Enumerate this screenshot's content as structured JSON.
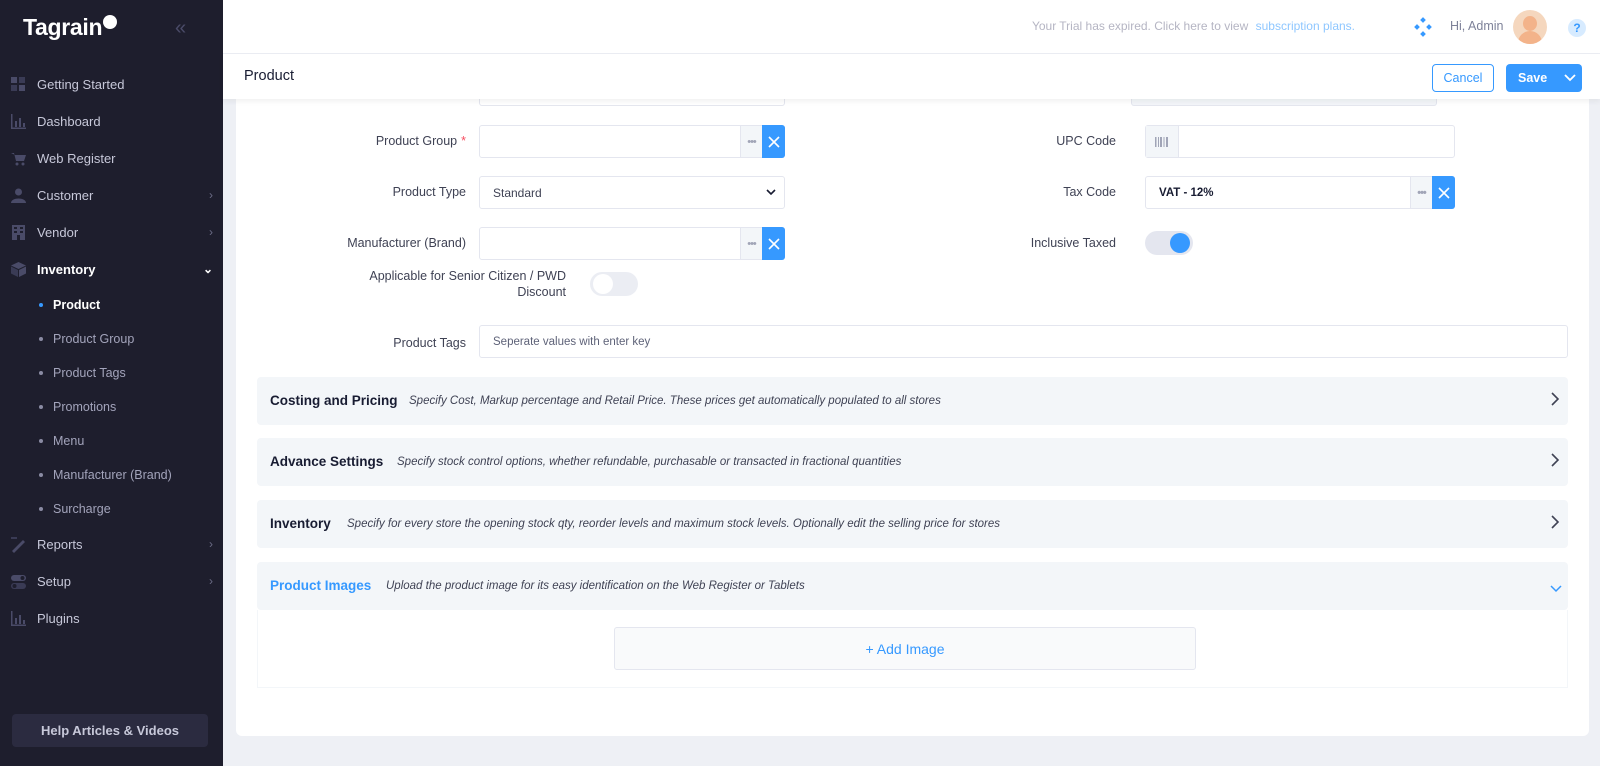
{
  "app": {
    "logo_text": "Tagrain",
    "help_label": "Help Articles & Videos"
  },
  "sidebar": {
    "items": [
      {
        "label": "Getting Started",
        "icon": "grid-icon"
      },
      {
        "label": "Dashboard",
        "icon": "bar-chart-icon"
      },
      {
        "label": "Web Register",
        "icon": "cart-icon"
      },
      {
        "label": "Customer",
        "icon": "user-icon"
      },
      {
        "label": "Vendor",
        "icon": "building-icon"
      },
      {
        "label": "Inventory",
        "icon": "box-icon"
      },
      {
        "label": "Reports",
        "icon": "pencil-ruler-icon"
      },
      {
        "label": "Setup",
        "icon": "toggle-icon"
      },
      {
        "label": "Plugins",
        "icon": "bar-chart-icon"
      }
    ],
    "inventory_sub": [
      "Product",
      "Product Group",
      "Product Tags",
      "Promotions",
      "Menu",
      "Manufacturer (Brand)",
      "Surcharge"
    ]
  },
  "topbar": {
    "trial_text": "Your Trial has expired. Click here to view",
    "trial_link": "subscription plans.",
    "greeting": "Hi, Admin",
    "help_glyph": "?"
  },
  "subheader": {
    "title": "Product",
    "cancel": "Cancel",
    "save": "Save"
  },
  "form": {
    "product_group": {
      "label": "Product Group",
      "required_mark": "*",
      "value": ""
    },
    "product_type": {
      "label": "Product Type",
      "value": "Standard"
    },
    "manufacturer": {
      "label": "Manufacturer (Brand)",
      "value": ""
    },
    "senior_discount": {
      "label_line1": "Applicable for Senior Citizen / PWD",
      "label_line2": "Discount",
      "enabled": false
    },
    "upc_code": {
      "label": "UPC Code",
      "value": ""
    },
    "tax_code": {
      "label": "Tax Code",
      "value": "VAT - 12%"
    },
    "inclusive_taxed": {
      "label": "Inclusive Taxed",
      "enabled": true
    },
    "product_tags": {
      "label": "Product Tags",
      "placeholder": "Seperate values with enter key"
    }
  },
  "sections": [
    {
      "title": "Costing and Pricing",
      "desc": "Specify Cost, Markup percentage and Retail Price. These prices get automatically populated to all stores",
      "expanded": false
    },
    {
      "title": "Advance Settings",
      "desc": "Specify stock control options, whether refundable, purchasable or transacted in fractional quantities",
      "expanded": false
    },
    {
      "title": "Inventory",
      "desc": "Specify for every store the opening stock qty, reorder levels and maximum stock levels. Optionally edit the selling price for stores",
      "expanded": false
    },
    {
      "title": "Product Images",
      "desc": "Upload the product image for its easy identification on the Web Register or Tablets",
      "expanded": true
    }
  ],
  "images": {
    "add_label": "+ Add Image"
  },
  "colors": {
    "accent": "#3699ff",
    "sidebar_bg": "#1e1e2d",
    "section_bg": "#f3f6f9"
  }
}
